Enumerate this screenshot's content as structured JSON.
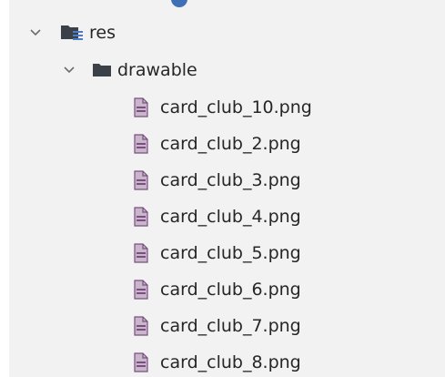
{
  "tree": {
    "res": {
      "label": "res",
      "expanded": true,
      "icon": "resource-folder-icon"
    },
    "drawable": {
      "label": "drawable",
      "expanded": true,
      "icon": "folder-icon"
    },
    "files": [
      {
        "label": "card_club_10.png",
        "icon": "image-file-icon"
      },
      {
        "label": "card_club_2.png",
        "icon": "image-file-icon"
      },
      {
        "label": "card_club_3.png",
        "icon": "image-file-icon"
      },
      {
        "label": "card_club_4.png",
        "icon": "image-file-icon"
      },
      {
        "label": "card_club_5.png",
        "icon": "image-file-icon"
      },
      {
        "label": "card_club_6.png",
        "icon": "image-file-icon"
      },
      {
        "label": "card_club_7.png",
        "icon": "image-file-icon"
      },
      {
        "label": "card_club_8.png",
        "icon": "image-file-icon"
      }
    ]
  },
  "colors": {
    "panel_background": "#f2f2f2",
    "text": "#262626",
    "chevron": "#6e6e6e",
    "folder_dark": "#3c4049",
    "resource_bars": "#4a7cc7",
    "image_file_body": "#c8b6c9",
    "image_file_outline": "#7d4e83"
  }
}
